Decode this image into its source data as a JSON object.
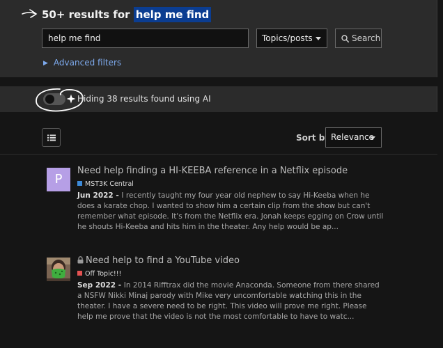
{
  "header": {
    "results_count": "50+ results for",
    "query_highlight": "help me find"
  },
  "search": {
    "value": "help me find",
    "type_select": "Topics/posts",
    "button_label": "Search"
  },
  "filters": {
    "advanced_label": "Advanced filters"
  },
  "ai": {
    "toggle_on": false,
    "text": "Hiding 38 results found using AI"
  },
  "sort": {
    "label": "Sort by",
    "value": "Relevance"
  },
  "colors": {
    "highlight": "#0b3d91",
    "link": "#7da9ec",
    "category_mst3k": "#3d8ad8",
    "category_offtopic": "#e45252",
    "avatar_p": "#b69fe6"
  },
  "results": [
    {
      "avatar_letter": "P",
      "title": "Need help finding a HI-KEEBA reference in a Netflix episode",
      "locked": false,
      "category": "MST3K Central",
      "date": "Jun 2022",
      "separator": " - ",
      "blurb": "I recently taught my four year old nephew to say Hi-Keeba when he does a karate chop. I wanted to show him a certain clip from the show but can't remember what episode. It's from the Netflix era. Jonah keeps egging on Crow until he shouts Hi-Keeba and hits him in the theater. Any help would be ap..."
    },
    {
      "avatar_letter": "",
      "title": "Need help to find a YouTube video",
      "locked": true,
      "category": "Off Topic!!!",
      "date": "Sep 2022",
      "separator": " - ",
      "blurb": "In 2014 Rifftrax did the movie Anaconda. Someone from there shared a NSFW Nikki Minaj parody with Mike very uncomfortable watching this in the theater. I have a severe need to be right. This video will prove me right. Please help me prove that the video is not the most comfortable to have to watc..."
    }
  ]
}
